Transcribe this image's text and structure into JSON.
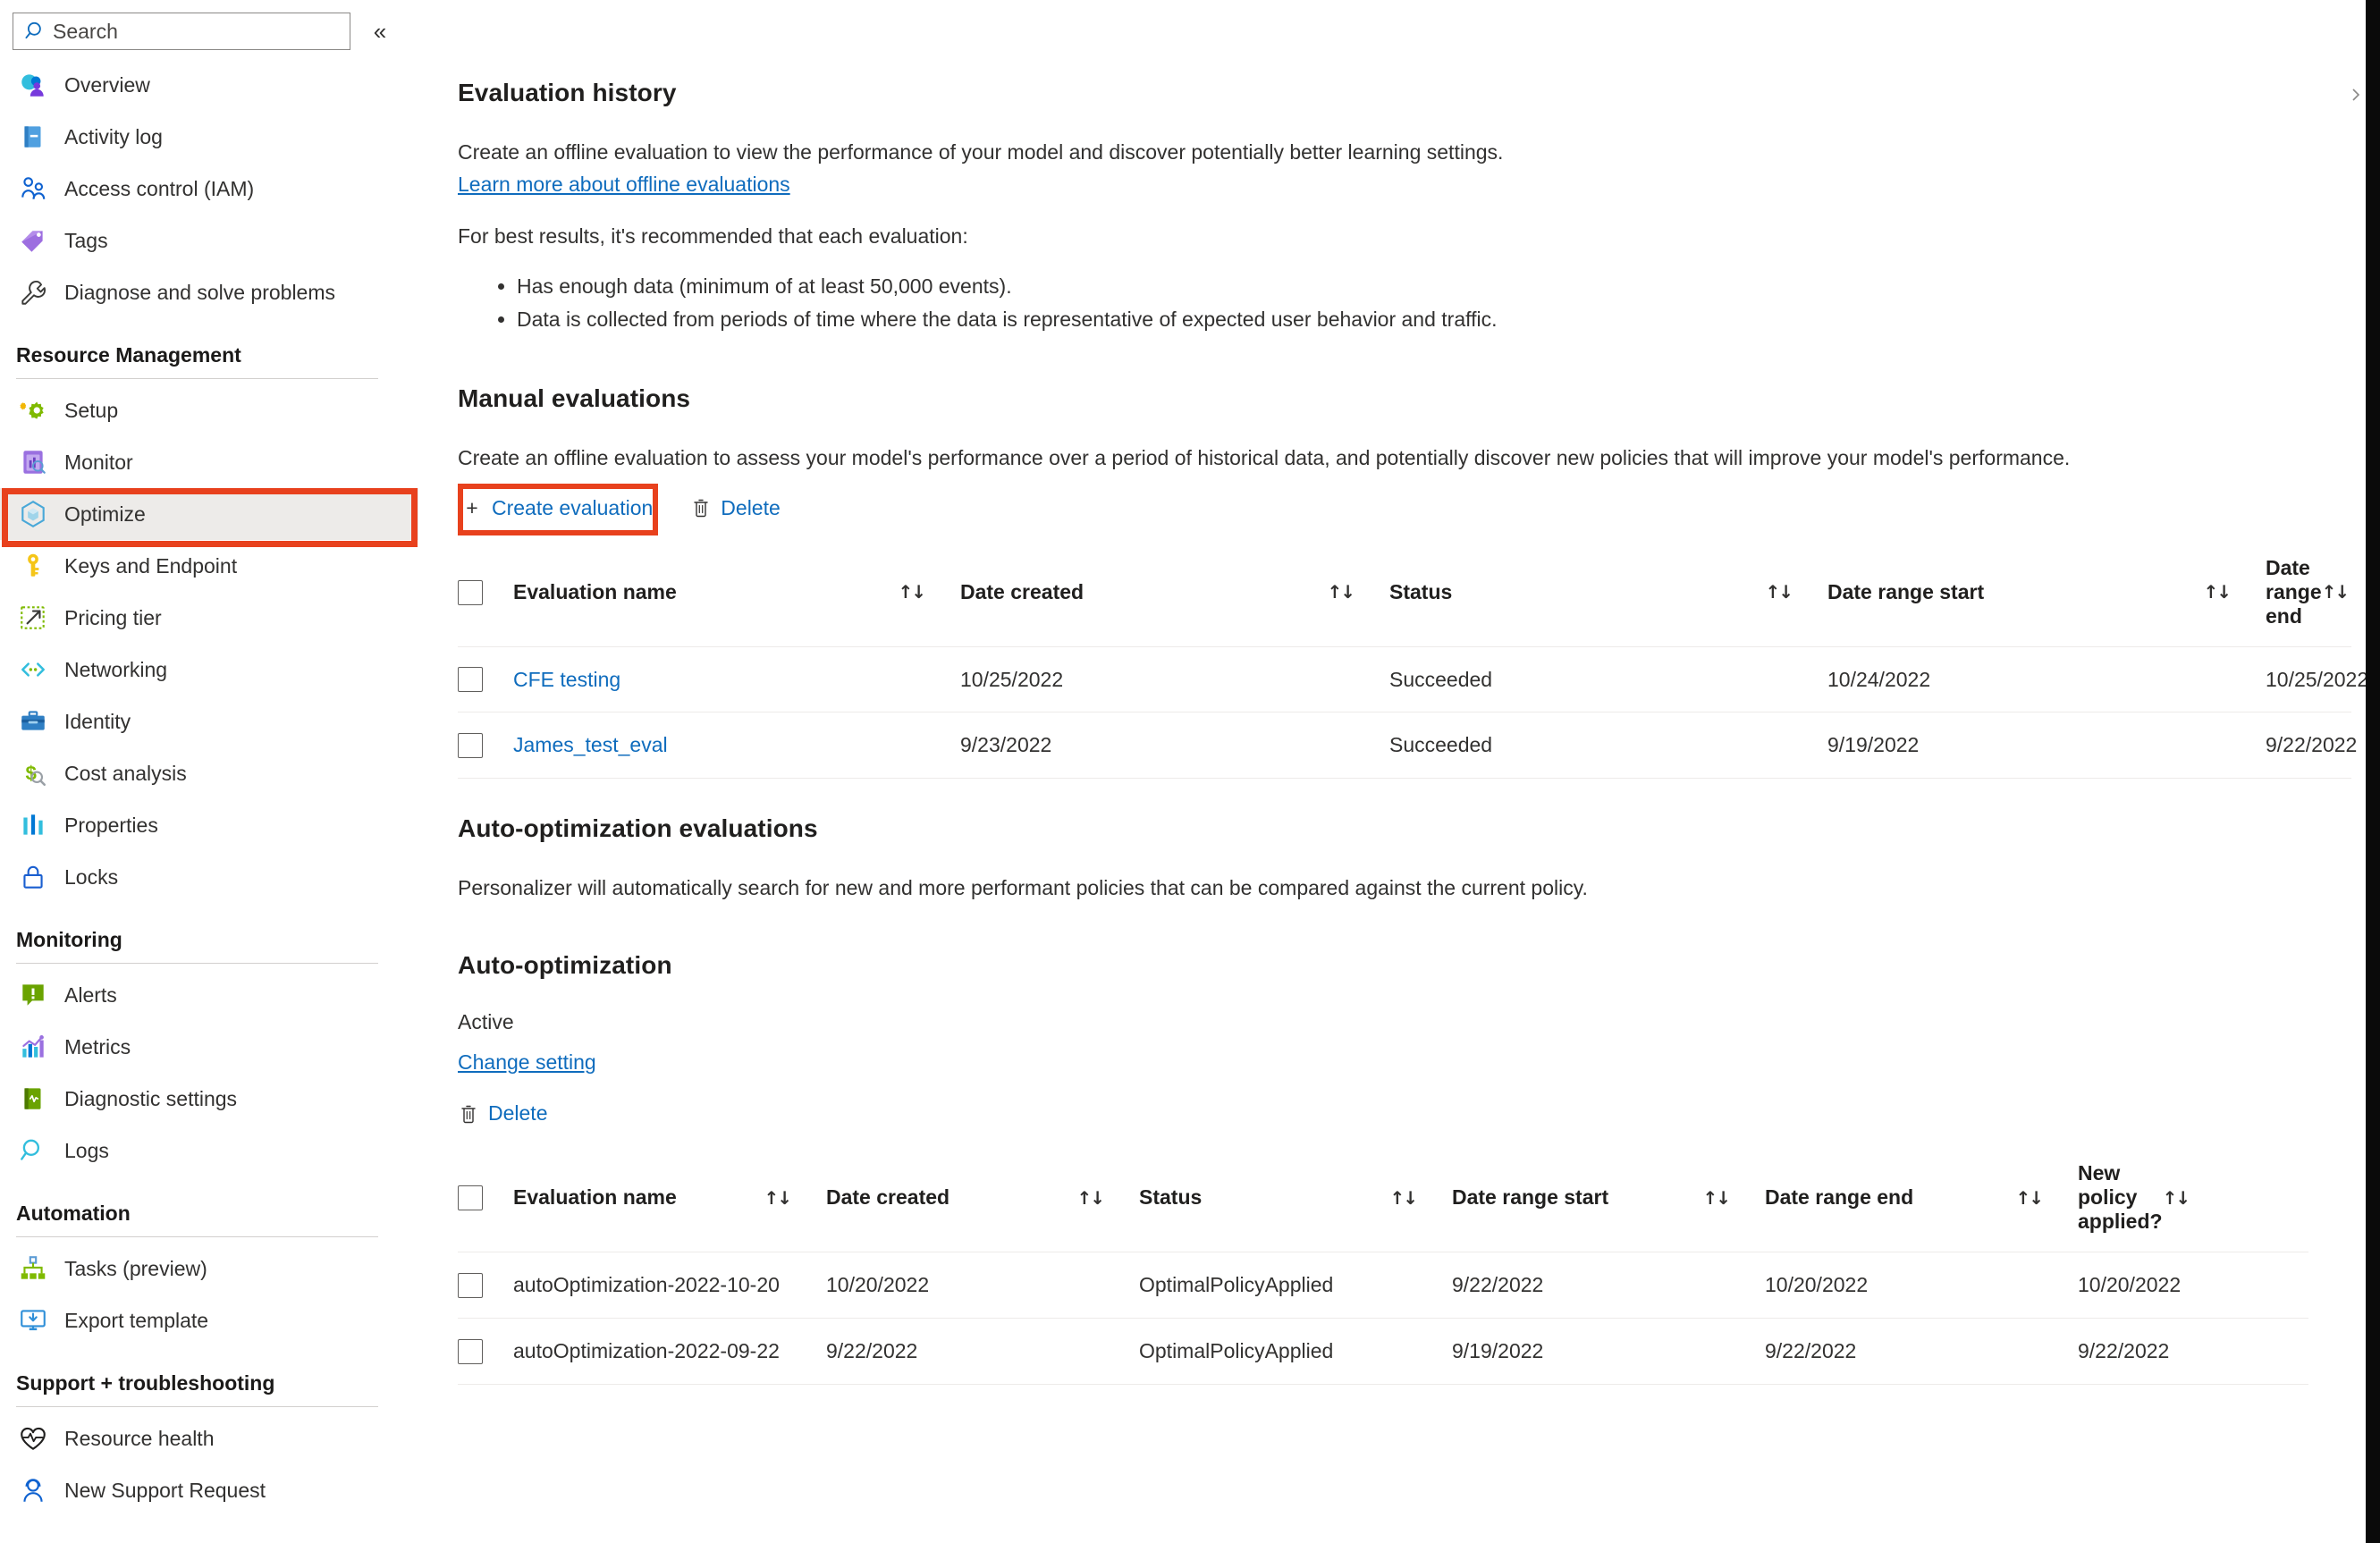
{
  "sidebar": {
    "search": {
      "placeholder": "Search",
      "value": ""
    },
    "collapse_label": "«",
    "items": [
      {
        "label": "Overview",
        "icon": "overview-icon"
      },
      {
        "label": "Activity log",
        "icon": "activity-log-icon"
      },
      {
        "label": "Access control (IAM)",
        "icon": "access-control-icon"
      },
      {
        "label": "Tags",
        "icon": "tags-icon"
      },
      {
        "label": "Diagnose and solve problems",
        "icon": "wrench-icon"
      }
    ],
    "sections": [
      {
        "title": "Resource Management",
        "items": [
          {
            "label": "Setup",
            "icon": "setup-gear-icon"
          },
          {
            "label": "Monitor",
            "icon": "monitor-icon"
          },
          {
            "label": "Optimize",
            "icon": "optimize-cube-icon",
            "selected": true
          },
          {
            "label": "Keys and Endpoint",
            "icon": "key-icon"
          },
          {
            "label": "Pricing tier",
            "icon": "pricing-tier-icon"
          },
          {
            "label": "Networking",
            "icon": "networking-icon"
          },
          {
            "label": "Identity",
            "icon": "identity-briefcase-icon"
          },
          {
            "label": "Cost analysis",
            "icon": "cost-analysis-icon"
          },
          {
            "label": "Properties",
            "icon": "properties-icon"
          },
          {
            "label": "Locks",
            "icon": "lock-icon"
          }
        ]
      },
      {
        "title": "Monitoring",
        "items": [
          {
            "label": "Alerts",
            "icon": "alerts-icon"
          },
          {
            "label": "Metrics",
            "icon": "metrics-icon"
          },
          {
            "label": "Diagnostic settings",
            "icon": "diagnostic-settings-icon"
          },
          {
            "label": "Logs",
            "icon": "logs-search-icon"
          }
        ]
      },
      {
        "title": "Automation",
        "items": [
          {
            "label": "Tasks (preview)",
            "icon": "tasks-icon"
          },
          {
            "label": "Export template",
            "icon": "export-template-icon"
          }
        ]
      },
      {
        "title": "Support + troubleshooting",
        "items": [
          {
            "label": "Resource health",
            "icon": "heart-pulse-icon"
          },
          {
            "label": "New Support Request",
            "icon": "support-person-icon"
          }
        ]
      }
    ]
  },
  "main": {
    "title": "Evaluation history",
    "intro_paragraph": "Create an offline evaluation to view the performance of your model and discover potentially better learning settings.",
    "intro_link": "Learn more about offline evaluations",
    "recommend_lead": "For best results, it's recommended that each evaluation:",
    "recommend_bullets": [
      "Has enough data (minimum of at least 50,000 events).",
      "Data is collected from periods of time where the data is representative of expected user behavior and traffic."
    ],
    "manual": {
      "title": "Manual evaluations",
      "description": "Create an offline evaluation to assess your model's performance over a period of historical data, and potentially discover new policies that will improve your model's performance.",
      "create_label": "Create evaluation",
      "create_glyph": "+",
      "delete_label": "Delete",
      "delete_glyph": "trash-icon",
      "columns": [
        "Evaluation name",
        "Date created",
        "Status",
        "Date range start",
        "Date range end"
      ],
      "rows": [
        {
          "name": "CFE testing",
          "date_created": "10/25/2022",
          "status": "Succeeded",
          "range_start": "10/24/2022",
          "range_end": "10/25/2022"
        },
        {
          "name": "James_test_eval",
          "date_created": "9/23/2022",
          "status": "Succeeded",
          "range_start": "9/19/2022",
          "range_end": "9/22/2022"
        }
      ]
    },
    "auto_eval": {
      "title": "Auto-optimization evaluations",
      "description": "Personalizer will automatically search for new and more performant policies that can be compared against the current policy."
    },
    "auto_opt": {
      "title": "Auto-optimization",
      "status": "Active",
      "change_setting_label": "Change setting",
      "delete_label": "Delete",
      "delete_glyph": "trash-icon",
      "columns": [
        "Evaluation name",
        "Date created",
        "Status",
        "Date range start",
        "Date range end",
        "New policy applied?"
      ],
      "rows": [
        {
          "name": "autoOptimization-2022-10-20",
          "date_created": "10/20/2022",
          "status": "OptimalPolicyApplied",
          "range_start": "9/22/2022",
          "range_end": "10/20/2022",
          "new_policy_applied": "10/20/2022"
        },
        {
          "name": "autoOptimization-2022-09-22",
          "date_created": "9/22/2022",
          "status": "OptimalPolicyApplied",
          "range_start": "9/19/2022",
          "range_end": "9/22/2022",
          "new_policy_applied": "9/22/2022"
        }
      ]
    }
  },
  "colors": {
    "link": "#0f6cbd",
    "annotation_red": "#e8411d",
    "selected_row": "#edebe9",
    "text": "#323130"
  }
}
